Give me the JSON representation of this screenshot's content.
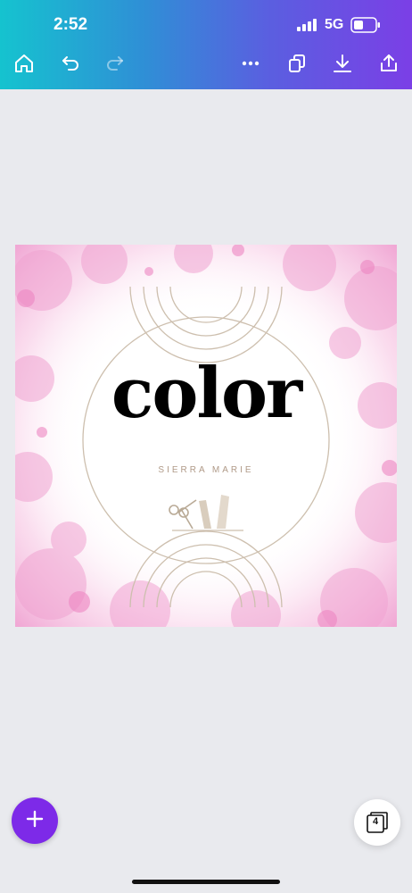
{
  "status_bar": {
    "time": "2:52",
    "network": "5G"
  },
  "toolbar": {
    "icons": [
      "home-icon",
      "undo-icon",
      "redo-icon",
      "more-icon",
      "duplicate-icon",
      "download-icon",
      "share-icon"
    ]
  },
  "design": {
    "title": "color",
    "subtitle": "SIERRA MARIE"
  },
  "pages": {
    "count": "4"
  },
  "colors": {
    "accent": "#7d2ae8",
    "gradient_start": "#15c3cf",
    "gradient_end": "#7b3fe6",
    "watercolor": "#f3a6d3",
    "line": "#cdbfae"
  }
}
